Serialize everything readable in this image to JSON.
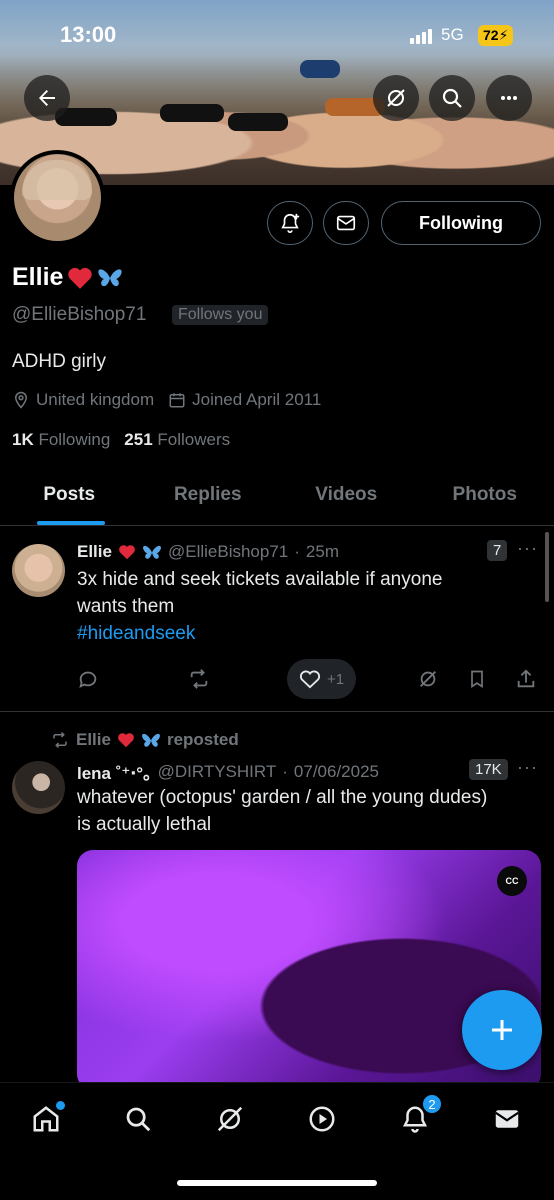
{
  "status_bar": {
    "time": "13:00",
    "network": "5G",
    "battery": "72"
  },
  "profile": {
    "name": "Ellie",
    "handle": "@EllieBishop71",
    "follows_you": "Follows you",
    "bio": "ADHD girly",
    "location": "United kingdom",
    "joined": "Joined April 2011",
    "following_count": "1K",
    "following_label": "Following",
    "followers_count": "251",
    "followers_label": "Followers",
    "follow_button": "Following"
  },
  "tabs": [
    {
      "label": "Posts",
      "active": true
    },
    {
      "label": "Replies"
    },
    {
      "label": "Videos"
    },
    {
      "label": "Photos"
    }
  ],
  "posts": [
    {
      "author": "Ellie",
      "handle": "@EllieBishop71",
      "time": "25m",
      "views": "7",
      "text": "3x hide and seek tickets available if anyone wants them",
      "hashtag": "#hideandseek",
      "likes": "+1"
    },
    {
      "repost_by": "Ellie",
      "repost_label": "reposted",
      "author": "lena ˚⁺‧°｡",
      "handle": "@DIRTYSHIRT",
      "date": "07/06/2025",
      "views": "17K",
      "text": "whatever (octopus' garden / all the young dudes) is actually lethal",
      "media_badge": "CC"
    }
  ],
  "nav": {
    "notifications_count": "2"
  },
  "colors": {
    "accent": "#1d9bf0",
    "background": "#000000",
    "muted": "#71767b"
  }
}
